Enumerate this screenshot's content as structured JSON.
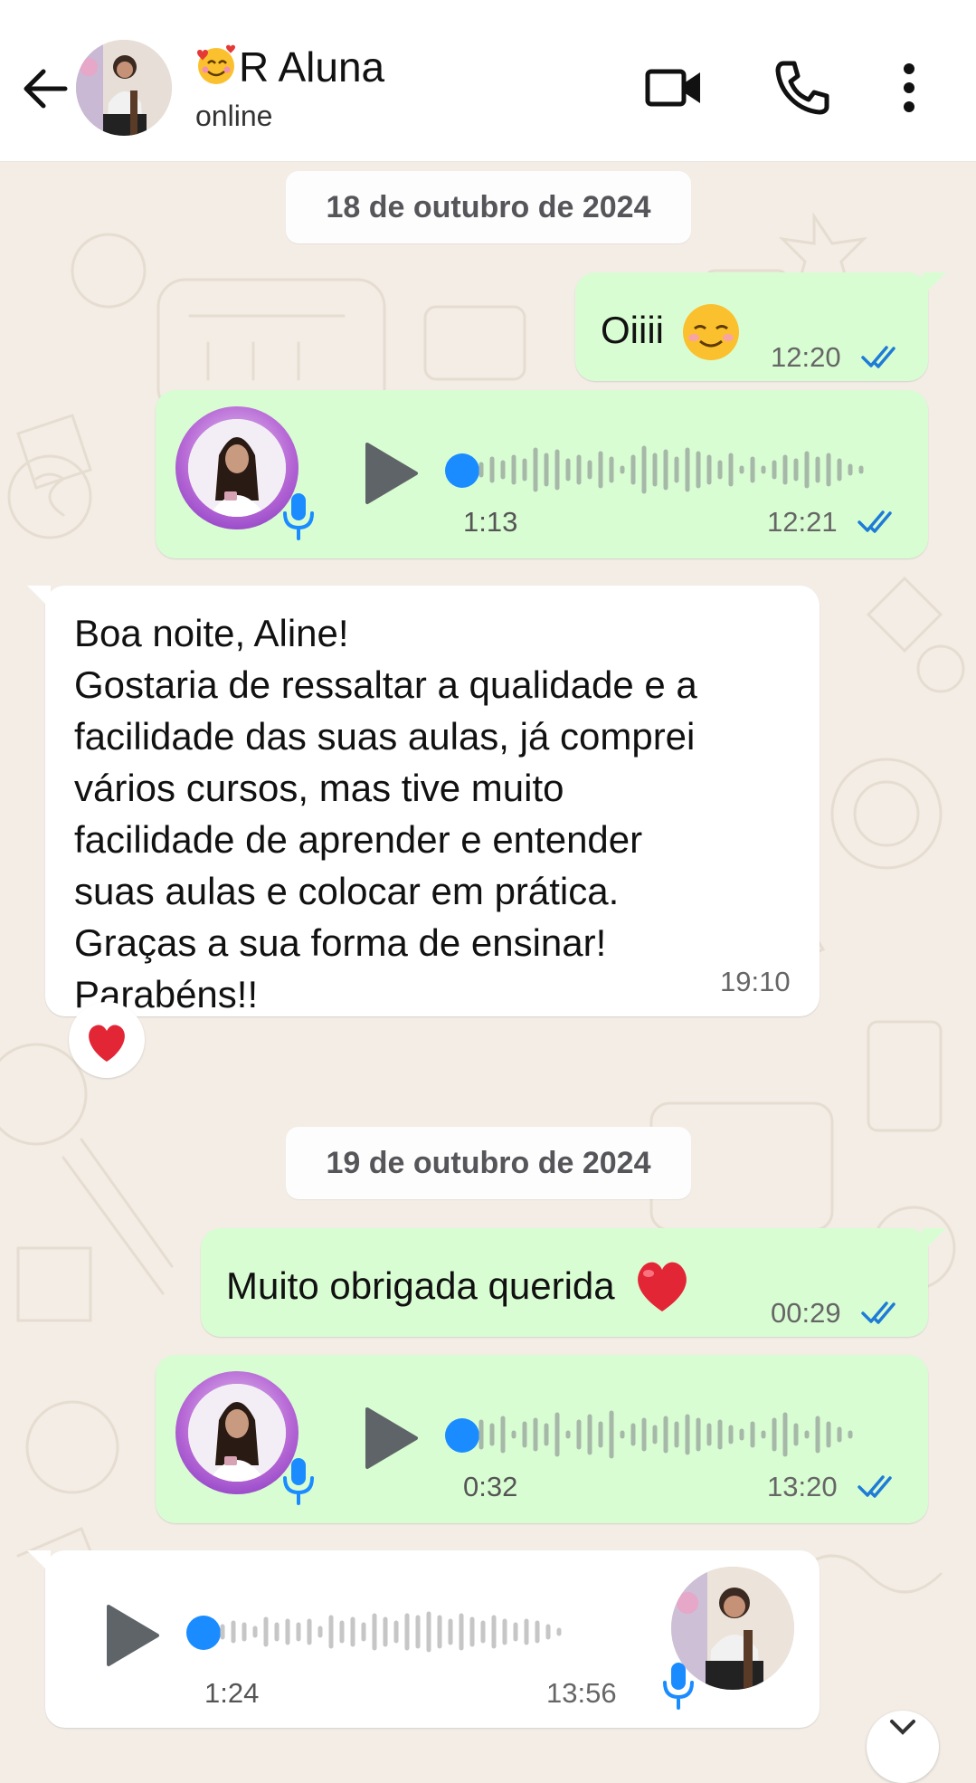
{
  "header": {
    "contact_name": "R Aluna",
    "status": "online",
    "emoji": "smiling-face-with-hearts"
  },
  "colors": {
    "outgoing_bubble": "#d9fdd3",
    "incoming_bubble": "#ffffff",
    "chat_background": "#f3ede6",
    "read_ticks": "#1f7cd6",
    "voice_dot": "#1a8cff"
  },
  "dates": [
    "18 de outubro de 2024",
    "19 de outubro de 2024"
  ],
  "messages": [
    {
      "type": "text",
      "direction": "out",
      "text": "Oiiii",
      "emoji": "smiling-face-emoji",
      "time": "12:20",
      "read": true
    },
    {
      "type": "voice",
      "direction": "out",
      "duration": "1:13",
      "time": "12:21",
      "read": true
    },
    {
      "type": "text",
      "direction": "in",
      "lines": [
        "Boa noite, Aline!",
        "Gostaria de ressaltar a qualidade e a",
        "facilidade das suas aulas, já comprei",
        "vários cursos, mas tive muito",
        "facilidade de aprender e entender",
        "suas aulas e colocar em prática.",
        "Graças a sua forma de ensinar!",
        "Parabéns!!"
      ],
      "time": "19:10",
      "reaction": "heart"
    },
    {
      "type": "text",
      "direction": "out",
      "text": "Muito obrigada querida",
      "emoji": "red-heart-emoji",
      "time": "00:29",
      "read": true
    },
    {
      "type": "voice",
      "direction": "out",
      "duration": "0:32",
      "time": "13:20",
      "read": true
    },
    {
      "type": "voice",
      "direction": "in",
      "duration": "1:24",
      "time": "13:56"
    }
  ]
}
